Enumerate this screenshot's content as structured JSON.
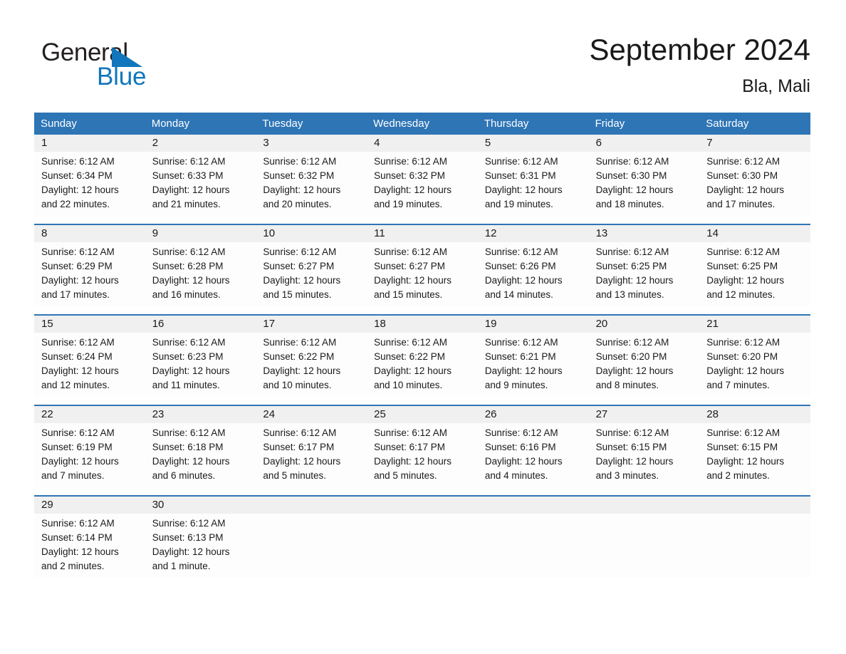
{
  "brand": {
    "name_part1": "General",
    "name_part2": "Blue",
    "triangle_icon": "triangle-icon",
    "color_black": "#231f20",
    "color_blue": "#1176bc"
  },
  "header": {
    "title": "September 2024",
    "location": "Bla, Mali"
  },
  "theme": {
    "header_bar": "#2e75b6",
    "day_band": "#f0f0f0",
    "rule": "#2e75b6",
    "text": "#1a1a1a"
  },
  "weekdays": [
    "Sunday",
    "Monday",
    "Tuesday",
    "Wednesday",
    "Thursday",
    "Friday",
    "Saturday"
  ],
  "labels": {
    "sunrise_prefix": "Sunrise:",
    "sunset_prefix": "Sunset:",
    "daylight_prefix": "Daylight:"
  },
  "weeks": [
    [
      {
        "day": "1",
        "sunrise": "Sunrise: 6:12 AM",
        "sunset": "Sunset: 6:34 PM",
        "daylight1": "Daylight: 12 hours",
        "daylight2": "and 22 minutes."
      },
      {
        "day": "2",
        "sunrise": "Sunrise: 6:12 AM",
        "sunset": "Sunset: 6:33 PM",
        "daylight1": "Daylight: 12 hours",
        "daylight2": "and 21 minutes."
      },
      {
        "day": "3",
        "sunrise": "Sunrise: 6:12 AM",
        "sunset": "Sunset: 6:32 PM",
        "daylight1": "Daylight: 12 hours",
        "daylight2": "and 20 minutes."
      },
      {
        "day": "4",
        "sunrise": "Sunrise: 6:12 AM",
        "sunset": "Sunset: 6:32 PM",
        "daylight1": "Daylight: 12 hours",
        "daylight2": "and 19 minutes."
      },
      {
        "day": "5",
        "sunrise": "Sunrise: 6:12 AM",
        "sunset": "Sunset: 6:31 PM",
        "daylight1": "Daylight: 12 hours",
        "daylight2": "and 19 minutes."
      },
      {
        "day": "6",
        "sunrise": "Sunrise: 6:12 AM",
        "sunset": "Sunset: 6:30 PM",
        "daylight1": "Daylight: 12 hours",
        "daylight2": "and 18 minutes."
      },
      {
        "day": "7",
        "sunrise": "Sunrise: 6:12 AM",
        "sunset": "Sunset: 6:30 PM",
        "daylight1": "Daylight: 12 hours",
        "daylight2": "and 17 minutes."
      }
    ],
    [
      {
        "day": "8",
        "sunrise": "Sunrise: 6:12 AM",
        "sunset": "Sunset: 6:29 PM",
        "daylight1": "Daylight: 12 hours",
        "daylight2": "and 17 minutes."
      },
      {
        "day": "9",
        "sunrise": "Sunrise: 6:12 AM",
        "sunset": "Sunset: 6:28 PM",
        "daylight1": "Daylight: 12 hours",
        "daylight2": "and 16 minutes."
      },
      {
        "day": "10",
        "sunrise": "Sunrise: 6:12 AM",
        "sunset": "Sunset: 6:27 PM",
        "daylight1": "Daylight: 12 hours",
        "daylight2": "and 15 minutes."
      },
      {
        "day": "11",
        "sunrise": "Sunrise: 6:12 AM",
        "sunset": "Sunset: 6:27 PM",
        "daylight1": "Daylight: 12 hours",
        "daylight2": "and 15 minutes."
      },
      {
        "day": "12",
        "sunrise": "Sunrise: 6:12 AM",
        "sunset": "Sunset: 6:26 PM",
        "daylight1": "Daylight: 12 hours",
        "daylight2": "and 14 minutes."
      },
      {
        "day": "13",
        "sunrise": "Sunrise: 6:12 AM",
        "sunset": "Sunset: 6:25 PM",
        "daylight1": "Daylight: 12 hours",
        "daylight2": "and 13 minutes."
      },
      {
        "day": "14",
        "sunrise": "Sunrise: 6:12 AM",
        "sunset": "Sunset: 6:25 PM",
        "daylight1": "Daylight: 12 hours",
        "daylight2": "and 12 minutes."
      }
    ],
    [
      {
        "day": "15",
        "sunrise": "Sunrise: 6:12 AM",
        "sunset": "Sunset: 6:24 PM",
        "daylight1": "Daylight: 12 hours",
        "daylight2": "and 12 minutes."
      },
      {
        "day": "16",
        "sunrise": "Sunrise: 6:12 AM",
        "sunset": "Sunset: 6:23 PM",
        "daylight1": "Daylight: 12 hours",
        "daylight2": "and 11 minutes."
      },
      {
        "day": "17",
        "sunrise": "Sunrise: 6:12 AM",
        "sunset": "Sunset: 6:22 PM",
        "daylight1": "Daylight: 12 hours",
        "daylight2": "and 10 minutes."
      },
      {
        "day": "18",
        "sunrise": "Sunrise: 6:12 AM",
        "sunset": "Sunset: 6:22 PM",
        "daylight1": "Daylight: 12 hours",
        "daylight2": "and 10 minutes."
      },
      {
        "day": "19",
        "sunrise": "Sunrise: 6:12 AM",
        "sunset": "Sunset: 6:21 PM",
        "daylight1": "Daylight: 12 hours",
        "daylight2": "and 9 minutes."
      },
      {
        "day": "20",
        "sunrise": "Sunrise: 6:12 AM",
        "sunset": "Sunset: 6:20 PM",
        "daylight1": "Daylight: 12 hours",
        "daylight2": "and 8 minutes."
      },
      {
        "day": "21",
        "sunrise": "Sunrise: 6:12 AM",
        "sunset": "Sunset: 6:20 PM",
        "daylight1": "Daylight: 12 hours",
        "daylight2": "and 7 minutes."
      }
    ],
    [
      {
        "day": "22",
        "sunrise": "Sunrise: 6:12 AM",
        "sunset": "Sunset: 6:19 PM",
        "daylight1": "Daylight: 12 hours",
        "daylight2": "and 7 minutes."
      },
      {
        "day": "23",
        "sunrise": "Sunrise: 6:12 AM",
        "sunset": "Sunset: 6:18 PM",
        "daylight1": "Daylight: 12 hours",
        "daylight2": "and 6 minutes."
      },
      {
        "day": "24",
        "sunrise": "Sunrise: 6:12 AM",
        "sunset": "Sunset: 6:17 PM",
        "daylight1": "Daylight: 12 hours",
        "daylight2": "and 5 minutes."
      },
      {
        "day": "25",
        "sunrise": "Sunrise: 6:12 AM",
        "sunset": "Sunset: 6:17 PM",
        "daylight1": "Daylight: 12 hours",
        "daylight2": "and 5 minutes."
      },
      {
        "day": "26",
        "sunrise": "Sunrise: 6:12 AM",
        "sunset": "Sunset: 6:16 PM",
        "daylight1": "Daylight: 12 hours",
        "daylight2": "and 4 minutes."
      },
      {
        "day": "27",
        "sunrise": "Sunrise: 6:12 AM",
        "sunset": "Sunset: 6:15 PM",
        "daylight1": "Daylight: 12 hours",
        "daylight2": "and 3 minutes."
      },
      {
        "day": "28",
        "sunrise": "Sunrise: 6:12 AM",
        "sunset": "Sunset: 6:15 PM",
        "daylight1": "Daylight: 12 hours",
        "daylight2": "and 2 minutes."
      }
    ],
    [
      {
        "day": "29",
        "sunrise": "Sunrise: 6:12 AM",
        "sunset": "Sunset: 6:14 PM",
        "daylight1": "Daylight: 12 hours",
        "daylight2": "and 2 minutes."
      },
      {
        "day": "30",
        "sunrise": "Sunrise: 6:12 AM",
        "sunset": "Sunset: 6:13 PM",
        "daylight1": "Daylight: 12 hours",
        "daylight2": "and 1 minute."
      },
      {
        "day": "",
        "sunrise": "",
        "sunset": "",
        "daylight1": "",
        "daylight2": ""
      },
      {
        "day": "",
        "sunrise": "",
        "sunset": "",
        "daylight1": "",
        "daylight2": ""
      },
      {
        "day": "",
        "sunrise": "",
        "sunset": "",
        "daylight1": "",
        "daylight2": ""
      },
      {
        "day": "",
        "sunrise": "",
        "sunset": "",
        "daylight1": "",
        "daylight2": ""
      },
      {
        "day": "",
        "sunrise": "",
        "sunset": "",
        "daylight1": "",
        "daylight2": ""
      }
    ]
  ]
}
